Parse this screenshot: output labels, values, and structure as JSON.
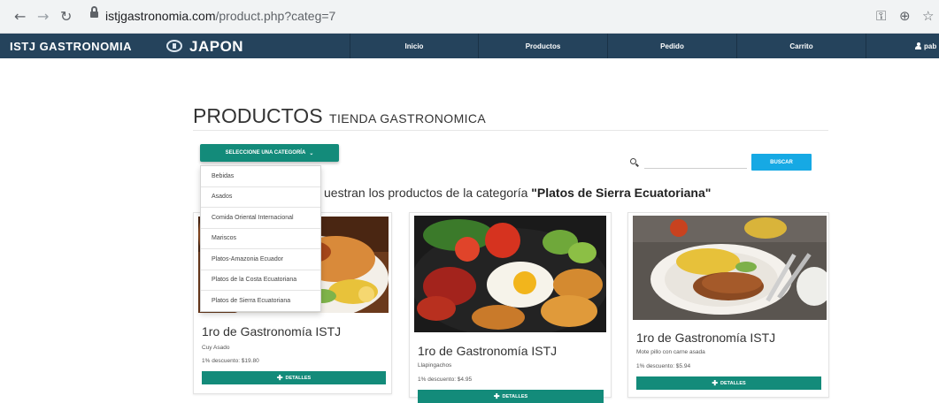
{
  "browser": {
    "url_host": "istjgastronomia.com",
    "url_path": "/product.php?categ=7"
  },
  "navbar": {
    "brand": "ISTJ GASTRONOMIA",
    "logo_text": "JAPON",
    "items": [
      "Inicio",
      "Productos",
      "Pedido",
      "Carrito"
    ],
    "user": "pab"
  },
  "page": {
    "heading": "PRODUCTOS",
    "heading_sub": "TIENDA GASTRONOMICA",
    "category_button": "SELECCIONE UNA CATEGORÍA",
    "search_button": "BUSCAR",
    "search_value": "",
    "subtitle_prefix": "uestran los productos de la categoría ",
    "subtitle_category": "\"Platos de Sierra Ecuatoriana\""
  },
  "categories": [
    "Bebidas",
    "Asados",
    "Comida Oriental Internacional",
    "Mariscos",
    "Platos-Amazonia Ecuador",
    "Platos de la Costa Ecuatoriana",
    "Platos de Sierra Ecuatoriana"
  ],
  "products": [
    {
      "title": "1ro de Gastronomía ISTJ",
      "name": "Cuy Asado",
      "price": "1% descuento: $19.80",
      "button": "DETALLES"
    },
    {
      "title": "1ro de Gastronomía ISTJ",
      "name": "Llapingachos",
      "price": "1% descuento: $4.95",
      "button": "DETALLES"
    },
    {
      "title": "1ro de Gastronomía ISTJ",
      "name": "Mote pillo con carne asada",
      "price": "1% descuento: $5.94",
      "button": "DETALLES"
    }
  ],
  "colors": {
    "navbar": "#25435c",
    "accent": "#138b7a",
    "search_button": "#16a9e4"
  }
}
